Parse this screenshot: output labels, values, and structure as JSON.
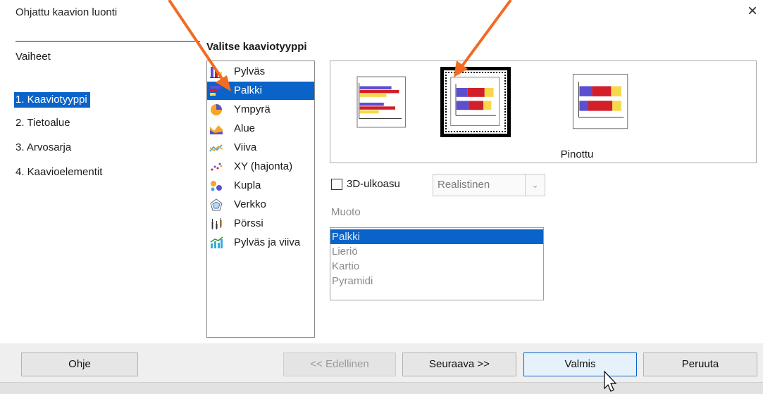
{
  "window": {
    "title": "Ohjattu kaavion luonti",
    "close_glyph": "×"
  },
  "steps": {
    "heading": "Vaiheet",
    "items": [
      {
        "label": "1. Kaaviotyyppi",
        "active": true
      },
      {
        "label": "2. Tietoalue",
        "active": false
      },
      {
        "label": "3. Arvosarja",
        "active": false
      },
      {
        "label": "4. Kaavioelementit",
        "active": false
      }
    ]
  },
  "chart_type": {
    "heading": "Valitse kaaviotyyppi",
    "types": [
      {
        "label": "Pylväs",
        "icon": "column-chart-icon"
      },
      {
        "label": "Palkki",
        "icon": "bar-chart-icon",
        "selected": true
      },
      {
        "label": "Ympyrä",
        "icon": "pie-chart-icon"
      },
      {
        "label": "Alue",
        "icon": "area-chart-icon"
      },
      {
        "label": "Viiva",
        "icon": "line-chart-icon"
      },
      {
        "label": "XY (hajonta)",
        "icon": "scatter-chart-icon"
      },
      {
        "label": "Kupla",
        "icon": "bubble-chart-icon"
      },
      {
        "label": "Verkko",
        "icon": "net-chart-icon"
      },
      {
        "label": "Pörssi",
        "icon": "stock-chart-icon"
      },
      {
        "label": "Pylväs ja viiva",
        "icon": "column-line-chart-icon"
      }
    ],
    "variant_caption": "Pinottu",
    "variants": [
      {
        "icon": "normal-bar-icon",
        "selected": false
      },
      {
        "icon": "stacked-bar-icon",
        "selected": true
      },
      {
        "icon": "percent-stacked-bar-icon",
        "selected": false
      }
    ],
    "three_d_label": "3D-ulkoasu",
    "three_d_checked": false,
    "three_d_style": "Realistinen",
    "shape_label": "Muoto",
    "shapes": [
      {
        "label": "Palkki",
        "selected": true
      },
      {
        "label": "Lieriö",
        "selected": false
      },
      {
        "label": "Kartio",
        "selected": false
      },
      {
        "label": "Pyramidi",
        "selected": false
      }
    ]
  },
  "buttons": {
    "help": "Ohje",
    "back": "<< Edellinen",
    "next": "Seuraava >>",
    "finish": "Valmis",
    "cancel": "Peruuta"
  },
  "colors": {
    "selection": "#0a63c8",
    "annotation_arrow": "#f26b21",
    "bar_blue": "#5b4fd0",
    "bar_red": "#d21f2a",
    "bar_yellow": "#f6d84a"
  }
}
